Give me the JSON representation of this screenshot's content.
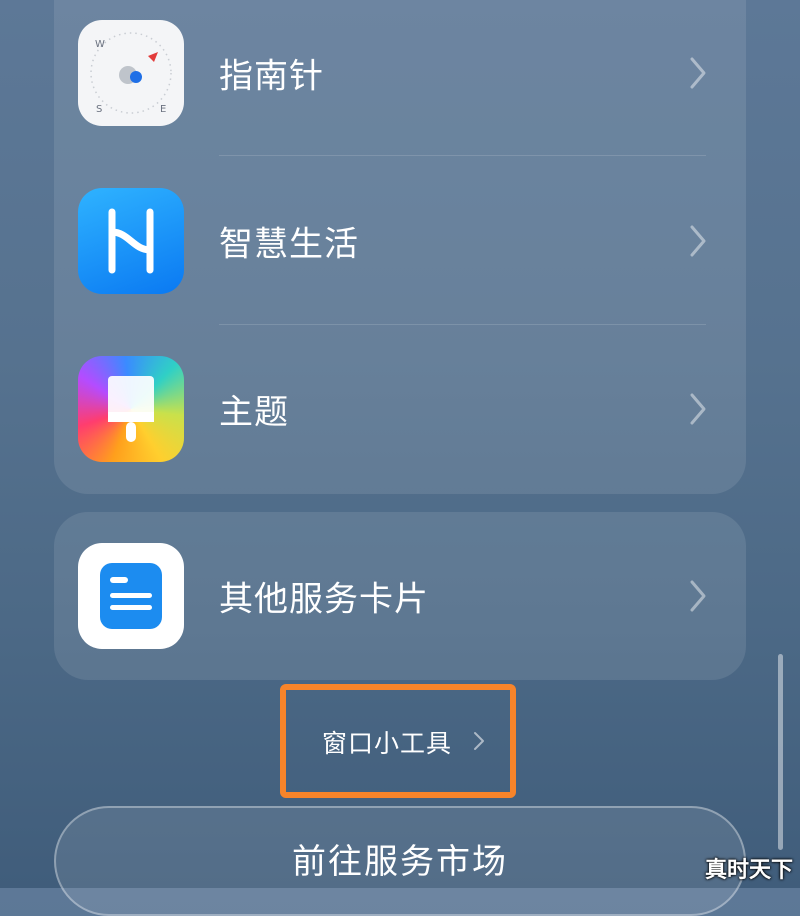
{
  "services": {
    "items": [
      {
        "label": "指南针",
        "icon": "compass-icon"
      },
      {
        "label": "智慧生活",
        "icon": "smart-life-icon"
      },
      {
        "label": "主题",
        "icon": "theme-brush-icon"
      }
    ],
    "other": {
      "label": "其他服务卡片",
      "icon": "service-card-icon"
    }
  },
  "compass_letters": {
    "w": "W",
    "s": "S",
    "e": "E"
  },
  "widgets_link": {
    "label": "窗口小工具",
    "highlight_color": "#f7842a"
  },
  "market_button": {
    "label": "前往服务市场"
  },
  "watermark": {
    "text": "真时天下"
  },
  "colors": {
    "background": "#56728f",
    "accent": "#f7842a"
  }
}
